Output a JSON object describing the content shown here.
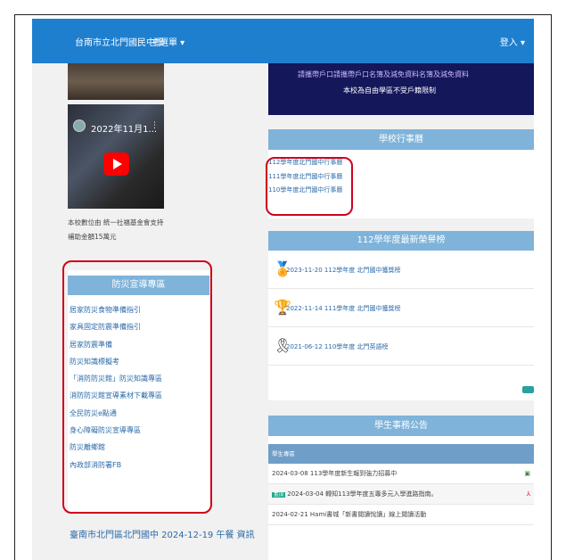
{
  "navbar": {
    "brand": "台南市立北門國民中學",
    "menu": "主選單 ▾",
    "login": "登入 ▾"
  },
  "video": {
    "title": "2022年11月1...",
    "menu_dots": "⋮"
  },
  "left_notes": [
    "本校數位由 統一社福基金會支持",
    "補助金額15萬元"
  ],
  "disaster": {
    "title": "防災宣導專區",
    "items": [
      "居家防災食物準備指引",
      "家具固定防震準備指引",
      "居家防震準備",
      "防災知識標擬考",
      "「消防防災館」防災知識專區",
      "消防防災館宣導素材下載專區",
      "全民防災e點通",
      "身心障礙防災宣導專區",
      "防災離鄉館",
      "內政部消防署FB"
    ]
  },
  "banner": {
    "line1": "請攜帶戶口請攜帶戶口名簿及減免資料名簿及減免資料",
    "line2": "本校為自由學區不受戶籍限制"
  },
  "schedule": {
    "title": "學校行事曆",
    "items": [
      "112學年度北門國中行事曆",
      "111學年度北門國中行事曆",
      "110學年度北門國中行事曆"
    ]
  },
  "honor": {
    "title": "112學年度最新榮譽榜",
    "items": [
      {
        "icon": "medal-icon",
        "text": "2023-11-20 112學年度 北門國中獲獎榜"
      },
      {
        "icon": "trophy-icon",
        "text": "2022-11-14 111學年度 北門國中獲獎榜"
      },
      {
        "icon": "ribbon-icon",
        "text": "2021-06-12 110學年度 北門英語榜"
      }
    ]
  },
  "news": {
    "title": "學生事務公告",
    "subheader": "學生專區",
    "rows": [
      {
        "text": "2024-03-08 113學年度新生報到強力招募中",
        "icon": "attachment-icon"
      },
      {
        "text": "2024-03-04 轉知113學年度五專多元入學進路指南。",
        "tag": "置頂",
        "icon": "pdf-icon"
      },
      {
        "text": "2024-02-21 Hami書城「新書閱讀悅讀」線上閱讀活動",
        "icon": ""
      }
    ]
  },
  "bottom_left": "臺南市北門區北門國中 2024-12-19 午餐 資訊",
  "colors": {
    "navbar": "#1e7fcf",
    "panel_header": "#7fb3da",
    "link": "#2a6aa8",
    "highlight_box": "#d0021b",
    "banner_bg": "#14175a"
  }
}
